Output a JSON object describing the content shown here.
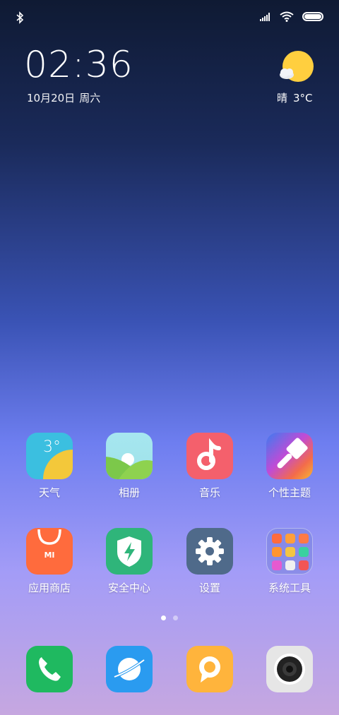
{
  "status_bar": {
    "bluetooth_icon": "bluetooth-icon",
    "signal_icon": "signal-icon",
    "wifi_icon": "wifi-icon",
    "battery_level": 1.0
  },
  "clock": {
    "time": "02:36",
    "date": "10月20日",
    "weekday": "周六"
  },
  "weather": {
    "condition": "晴",
    "temperature": "3°C"
  },
  "apps_row1": [
    {
      "label": "天气",
      "icon": "weather-app-icon",
      "badge_text": "3°"
    },
    {
      "label": "相册",
      "icon": "gallery-app-icon"
    },
    {
      "label": "音乐",
      "icon": "music-app-icon"
    },
    {
      "label": "个性主题",
      "icon": "themes-app-icon"
    }
  ],
  "apps_row2": [
    {
      "label": "应用商店",
      "icon": "app-store-icon",
      "badge_text": "MI"
    },
    {
      "label": "安全中心",
      "icon": "security-app-icon"
    },
    {
      "label": "设置",
      "icon": "settings-app-icon"
    },
    {
      "label": "系统工具",
      "icon": "folder-system-tools-icon"
    }
  ],
  "page_indicator": {
    "pages": 2,
    "current": 1
  },
  "dock": [
    {
      "icon": "phone-app-icon"
    },
    {
      "icon": "browser-app-icon"
    },
    {
      "icon": "messages-app-icon"
    },
    {
      "icon": "camera-app-icon"
    }
  ],
  "colors": {
    "weather": "#3bbfe0",
    "gallery": "#8ed24f",
    "music": "#f4606c",
    "store": "#ff6b3d",
    "security": "#2fb57a",
    "settings": "#4f6a8a",
    "phone": "#1fb960",
    "browser": "#2a9bf0",
    "messages": "#ffb43c",
    "camera": "#e6e6e6"
  }
}
